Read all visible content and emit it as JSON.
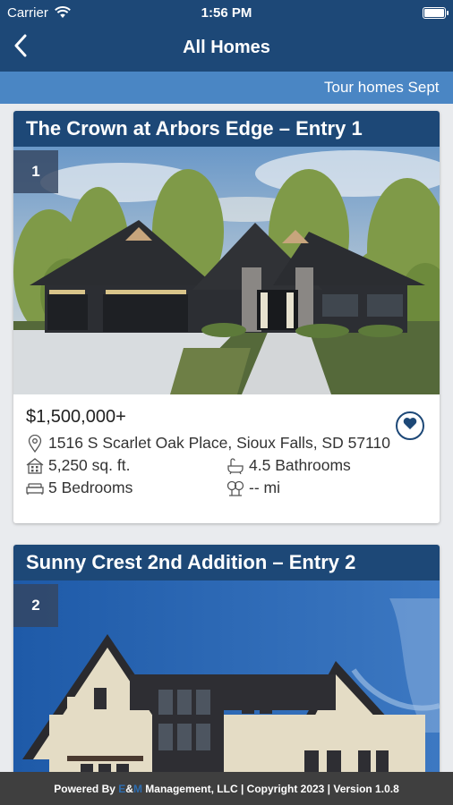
{
  "status_bar": {
    "carrier": "Carrier",
    "time": "1:56 PM"
  },
  "nav": {
    "title": "All Homes",
    "back_icon": "chevron-left-icon"
  },
  "ticker": {
    "text": "Tour homes Sept"
  },
  "homes": [
    {
      "title": "The Crown at Arbors Edge – Entry 1",
      "entry_number": "1",
      "price": "$1,500,000+",
      "address": "1516 S Scarlet Oak Place, Sioux Falls, SD 57110",
      "sqft": "5,250 sq. ft.",
      "bathrooms": "4.5 Bathrooms",
      "bedrooms": "5 Bedrooms",
      "distance": "-- mi"
    },
    {
      "title": "Sunny Crest 2nd Addition – Entry 2",
      "entry_number": "2"
    }
  ],
  "footer": {
    "prefix": "Powered By ",
    "brand_e": "E",
    "brand_amp": "&",
    "brand_m": "M",
    "suffix": " Management, LLC | Copyright 2023 | Version 1.0.8"
  },
  "colors": {
    "primary": "#1d4877",
    "ticker": "#4a86c4",
    "footer": "#3f3f3f",
    "background": "#e9ebee"
  }
}
